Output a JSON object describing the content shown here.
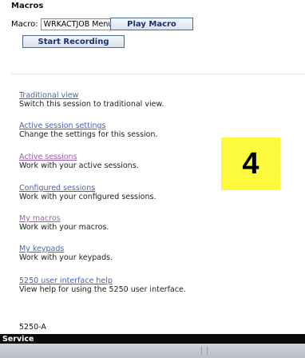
{
  "macros": {
    "title": "Macros",
    "label": "Macro:",
    "selected": "WRKACTJOB Menu",
    "play_label": "Play Macro",
    "record_label": "Start Recording"
  },
  "nav": [
    {
      "link": "Traditional view",
      "desc": "Switch this session to traditional view."
    },
    {
      "link": "Active session settings",
      "desc": "Change the settings for this session."
    },
    {
      "link": "Active sessions",
      "desc": "Work with your active sessions."
    },
    {
      "link": "Configured sessions",
      "desc": "Work with your configured sessions."
    },
    {
      "link": "My macros",
      "desc": "Work with your macros."
    },
    {
      "link": "My keypads",
      "desc": "Work with your keypads."
    },
    {
      "link": "5250 user interface help",
      "desc": "View help for using the 5250 user interface."
    }
  ],
  "badge": "4",
  "session_id": "5250-A",
  "status_bar": "Service",
  "colors": {
    "link": "#4a63b0",
    "visited_link": "#a05cb0",
    "badge": "#fdf93c",
    "status_bar": "#0a0a0a"
  }
}
